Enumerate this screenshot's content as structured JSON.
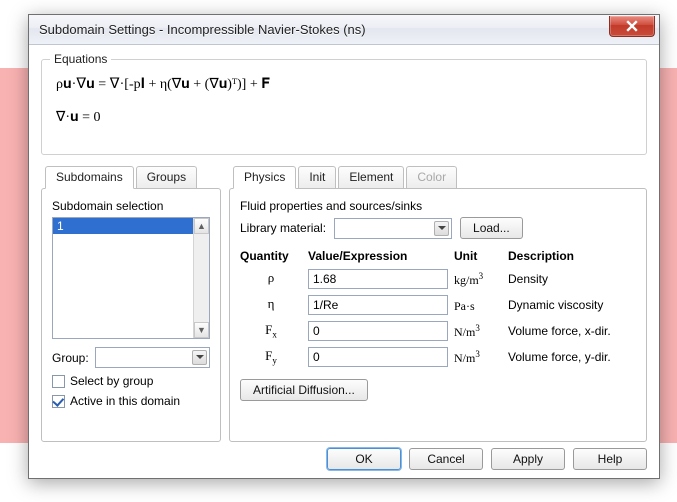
{
  "window": {
    "title": "Subdomain Settings - Incompressible Navier-Stokes (ns)"
  },
  "equations": {
    "legend": "Equations",
    "line1": "ρ𝐮·∇𝐮 = ∇·[-p𝐈 + η(∇𝐮 + (∇𝐮)ᵀ)] + 𝐅",
    "line2": "∇·𝐮 = 0"
  },
  "left_tabs": {
    "subdomains": "Subdomains",
    "groups": "Groups"
  },
  "subdomain": {
    "selection_label": "Subdomain selection",
    "items": [
      "1"
    ],
    "group_label": "Group:",
    "select_by_group": "Select by group",
    "active_in_domain": "Active in this domain"
  },
  "right_tabs": {
    "physics": "Physics",
    "init": "Init",
    "element": "Element",
    "color": "Color"
  },
  "physics": {
    "subtitle": "Fluid properties and sources/sinks",
    "library_label": "Library material:",
    "load_button": "Load...",
    "headers": {
      "q": "Quantity",
      "v": "Value/Expression",
      "u": "Unit",
      "d": "Description"
    },
    "rows": [
      {
        "sym": "ρ",
        "sub": "",
        "value": "1.68",
        "unit_base": "kg/m",
        "unit_sup": "3",
        "unit_suffix": "",
        "desc": "Density"
      },
      {
        "sym": "η",
        "sub": "",
        "value": "1/Re",
        "unit_base": "Pa·s",
        "unit_sup": "",
        "unit_suffix": "",
        "desc": "Dynamic viscosity"
      },
      {
        "sym": "F",
        "sub": "x",
        "value": "0",
        "unit_base": "N/m",
        "unit_sup": "3",
        "unit_suffix": "",
        "desc": "Volume force, x-dir."
      },
      {
        "sym": "F",
        "sub": "y",
        "value": "0",
        "unit_base": "N/m",
        "unit_sup": "3",
        "unit_suffix": "",
        "desc": "Volume force, y-dir."
      }
    ],
    "artificial_diffusion": "Artificial Diffusion..."
  },
  "footer": {
    "ok": "OK",
    "cancel": "Cancel",
    "apply": "Apply",
    "help": "Help"
  }
}
